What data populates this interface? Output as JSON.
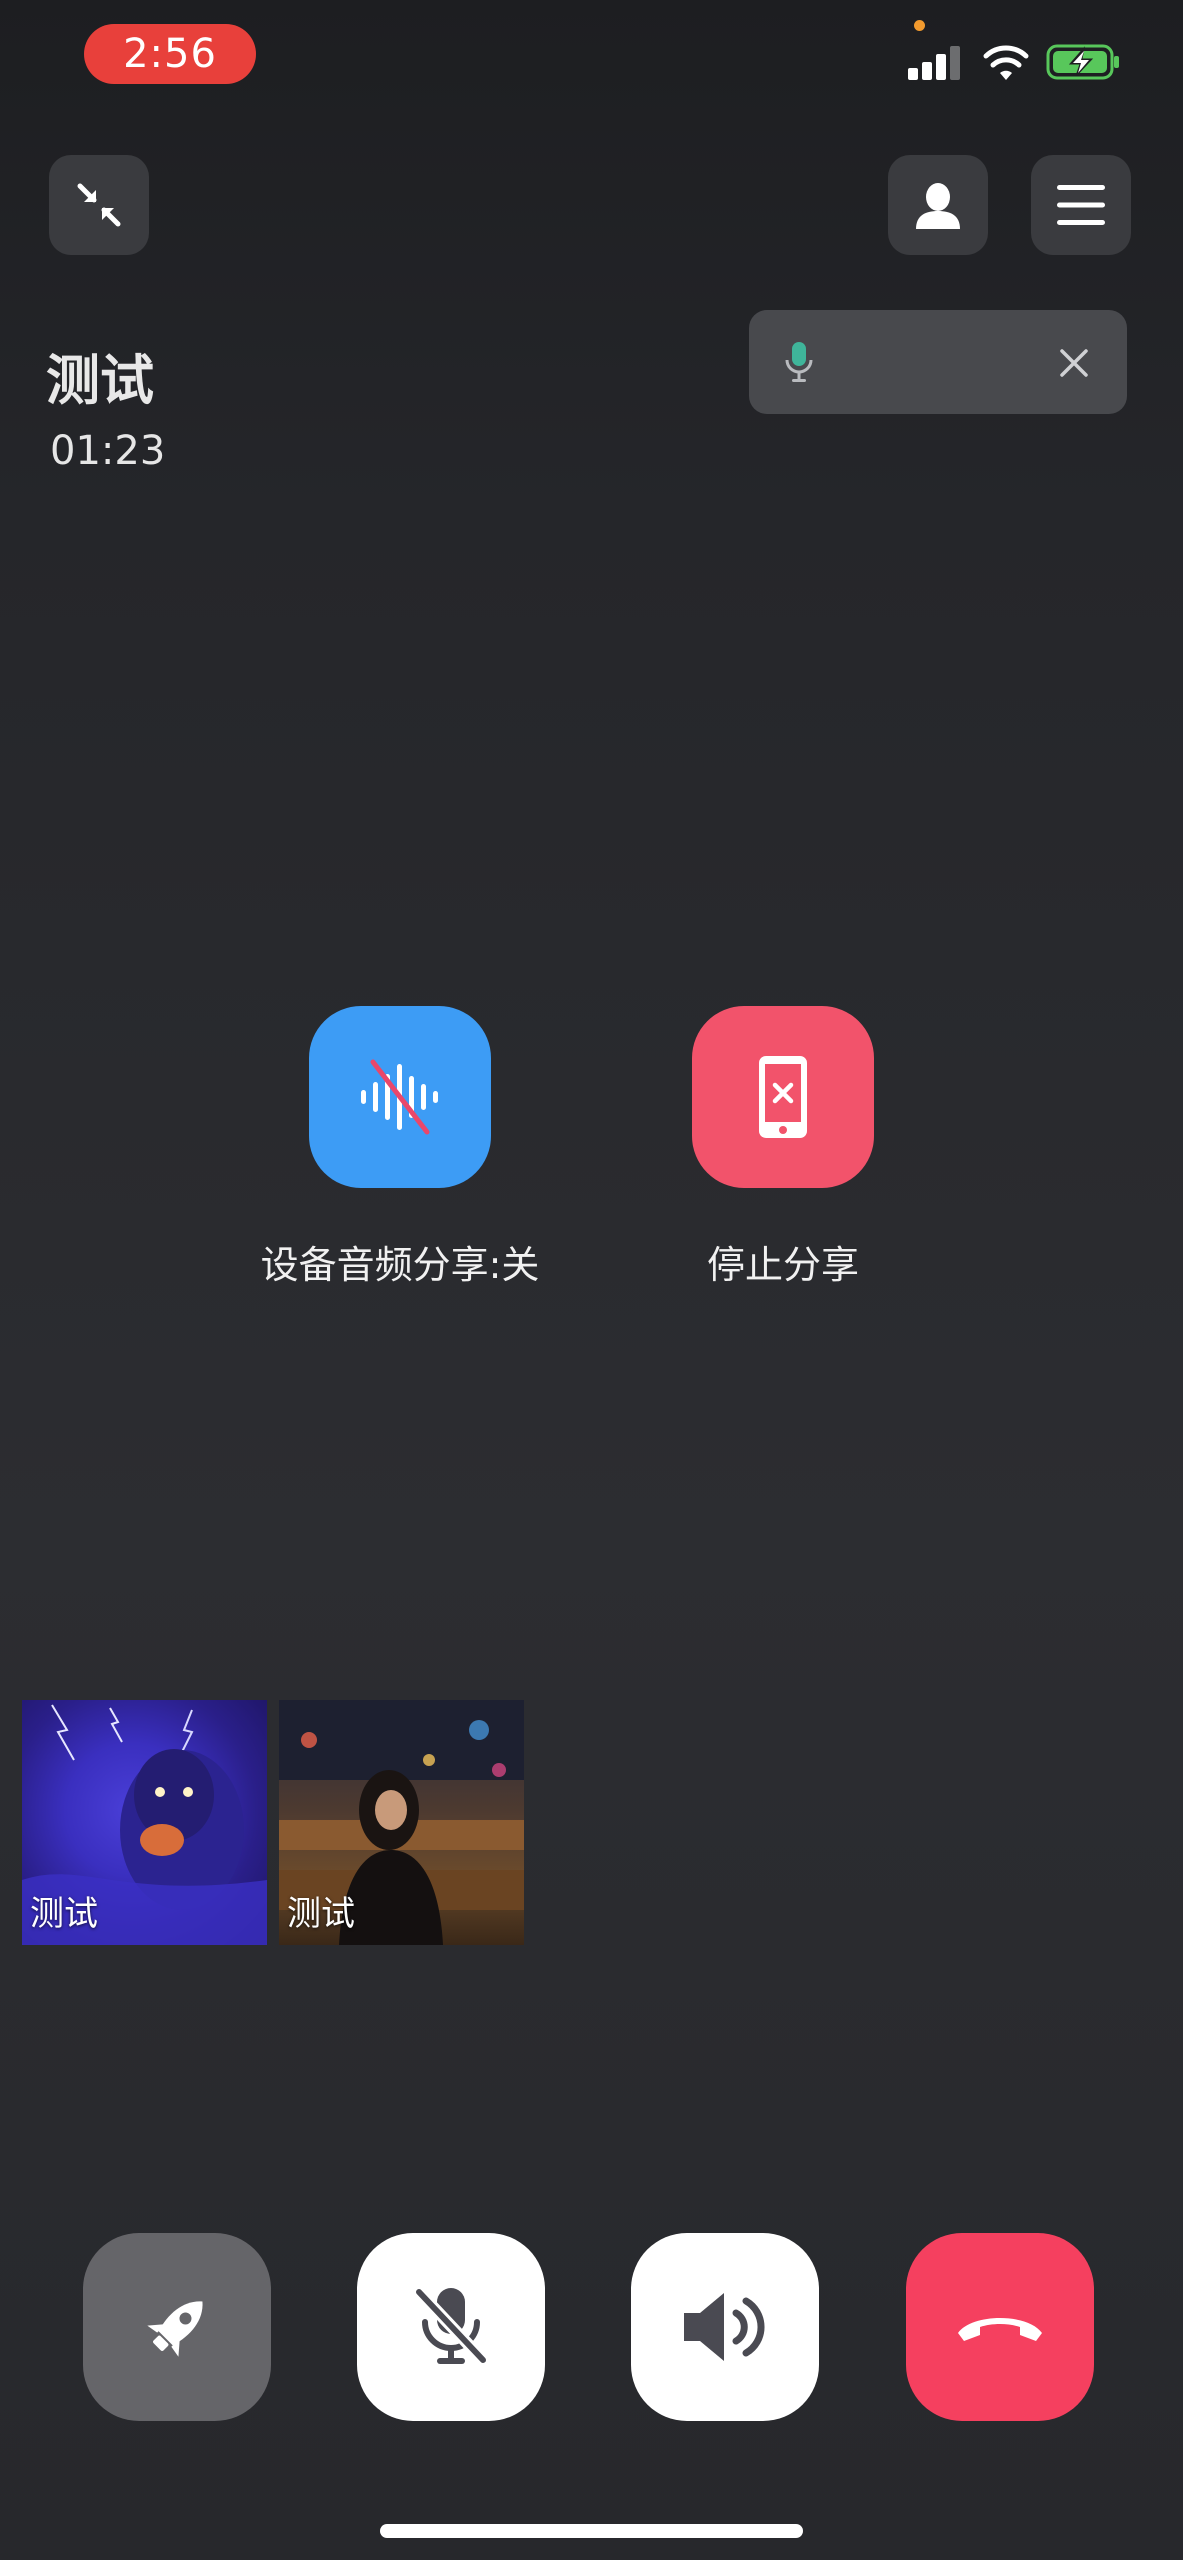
{
  "status_bar": {
    "time": "2:56"
  },
  "call": {
    "name": "测试",
    "timer": "01:23"
  },
  "actions": {
    "audio_share_label": "设备音频分享:关",
    "stop_share_label": "停止分享"
  },
  "participants": [
    {
      "label": "测试",
      "avatar": "blue-storm-avatar"
    },
    {
      "label": "测试",
      "avatar": "night-street-avatar"
    }
  ],
  "controls": {
    "items": [
      "rocket-button",
      "microphone-muted-button",
      "speaker-button",
      "hangup-button"
    ]
  },
  "colors": {
    "time_pill": "#e8403b",
    "audio_share": "#3d9cf5",
    "stop_share": "#f2536b",
    "hangup": "#f5405f",
    "rocket_bg": "#656569",
    "white_btn": "#ffffff"
  }
}
